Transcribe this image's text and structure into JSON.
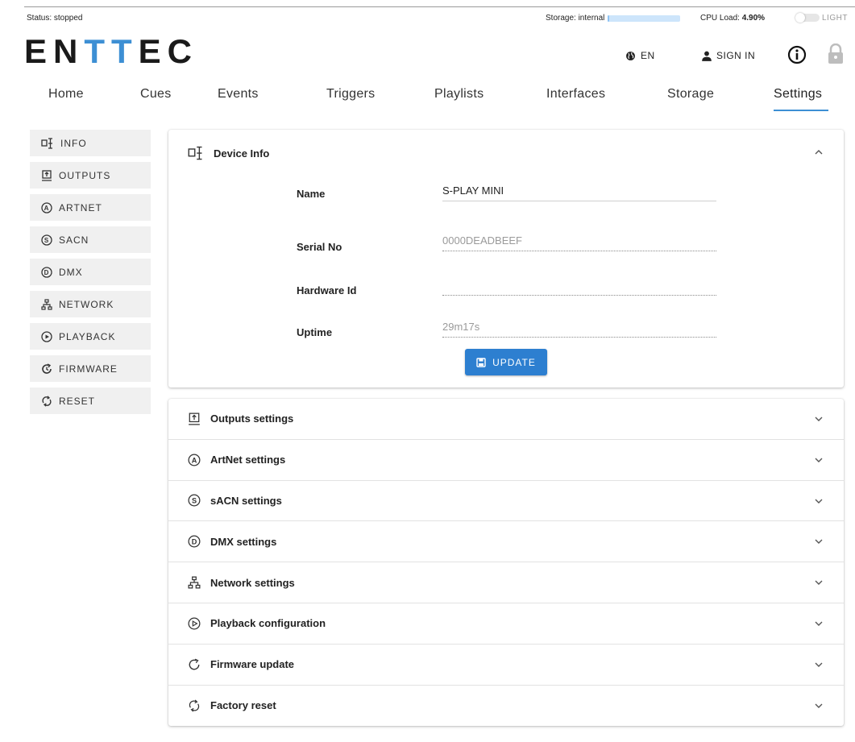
{
  "topbar": {
    "status": "Status: stopped",
    "storage_label": "Storage: internal",
    "storage_fill_fraction": 0.02,
    "cpu_label": "CPU Load:",
    "cpu_value": "4.90%",
    "theme_toggle_label": "LIGHT"
  },
  "brand": {
    "logo_part1": "EN",
    "logo_part2": "TT",
    "logo_part3": "EC",
    "dark_color": "#1a1a1a",
    "accent_color": "#3d8fd4"
  },
  "header": {
    "language": "EN",
    "sign_in": "SIGN IN",
    "language_icon": "globe-icon",
    "sign_in_icon": "user-icon",
    "info_icon": "info-icon",
    "lock_icon": "lock-icon"
  },
  "nav": {
    "tabs": [
      {
        "label": "Home"
      },
      {
        "label": "Cues"
      },
      {
        "label": "Events"
      },
      {
        "label": "Triggers"
      },
      {
        "label": "Playlists"
      },
      {
        "label": "Interfaces"
      },
      {
        "label": "Storage"
      },
      {
        "label": "Settings"
      }
    ],
    "active": "Settings"
  },
  "sidebar": {
    "items": [
      {
        "label": "INFO",
        "icon": "device-info-icon"
      },
      {
        "label": "OUTPUTS",
        "icon": "outputs-icon"
      },
      {
        "label": "ARTNET",
        "icon": "artnet-icon"
      },
      {
        "label": "SACN",
        "icon": "sacn-icon"
      },
      {
        "label": "DMX",
        "icon": "dmx-icon"
      },
      {
        "label": "NETWORK",
        "icon": "network-icon"
      },
      {
        "label": "PLAYBACK",
        "icon": "playback-icon"
      },
      {
        "label": "FIRMWARE",
        "icon": "firmware-icon"
      },
      {
        "label": "RESET",
        "icon": "reset-icon"
      }
    ]
  },
  "device_info": {
    "title": "Device Info",
    "fields": [
      {
        "label": "Name",
        "value": "S-PLAY MINI"
      },
      {
        "label": "Serial No",
        "value": "0000DEADBEEF"
      },
      {
        "label": "Hardware Id",
        "value": ""
      },
      {
        "label": "Uptime",
        "value": "29m17s"
      }
    ],
    "update_button": "UPDATE"
  },
  "sections": [
    {
      "title": "Outputs settings",
      "icon": "outputs-icon"
    },
    {
      "title": "ArtNet settings",
      "icon": "artnet-icon"
    },
    {
      "title": "sACN settings",
      "icon": "sacn-icon"
    },
    {
      "title": "DMX settings",
      "icon": "dmx-icon"
    },
    {
      "title": "Network settings",
      "icon": "network-icon"
    },
    {
      "title": "Playback configuration",
      "icon": "playback-icon"
    },
    {
      "title": "Firmware update",
      "icon": "firmware-icon"
    },
    {
      "title": "Factory reset",
      "icon": "reset-icon"
    }
  ]
}
